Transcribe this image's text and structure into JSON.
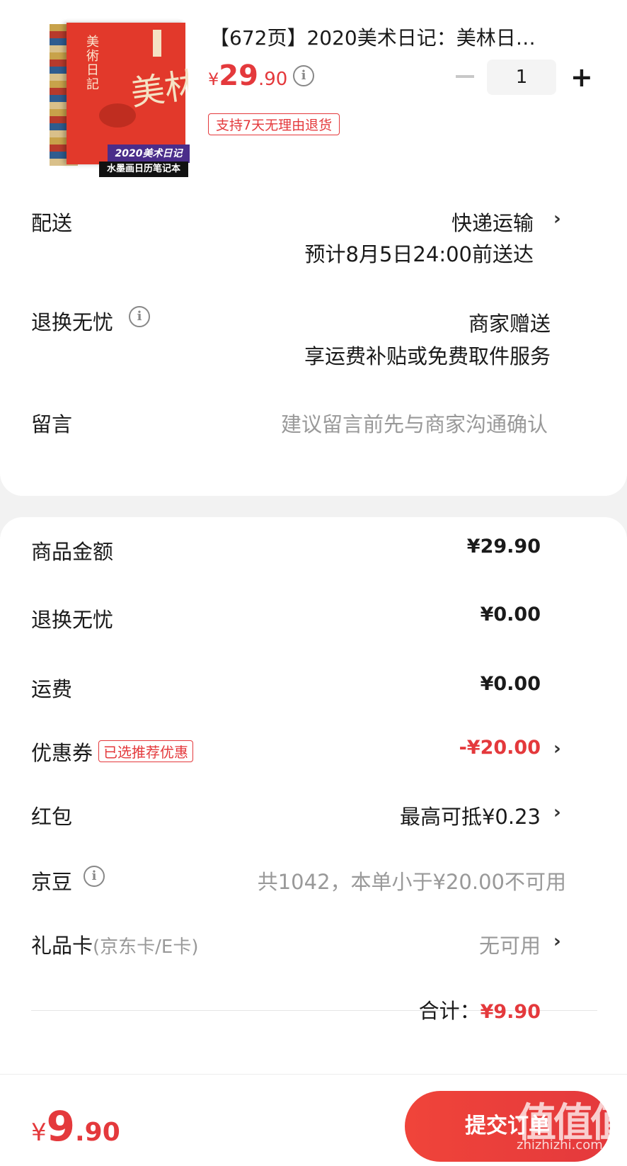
{
  "product": {
    "cover_vertical_title": "美術日記",
    "cover_big_char": "美林",
    "cover_banner_1": "2020美术日记",
    "cover_banner_2": "水墨画日历笔记本",
    "title": "【672页】2020美术日记：美林日…",
    "price_yen": "¥",
    "price_int": "29",
    "price_dec": ".90",
    "quantity": "1",
    "return_tag": "支持7天无理由退货"
  },
  "delivery": {
    "label": "配送",
    "method": "快递运输",
    "estimate": "预计8月5日24:00前送达"
  },
  "return_service": {
    "label": "退换无忧",
    "value": "商家赠送",
    "detail": "享运费补贴或免费取件服务"
  },
  "message": {
    "label": "留言",
    "placeholder": "建议留言前先与商家沟通确认"
  },
  "summary": {
    "goods_amount_label": "商品金额",
    "goods_amount": "¥29.90",
    "return_label": "退换无忧",
    "return_amount": "¥0.00",
    "shipping_label": "运费",
    "shipping_amount": "¥0.00",
    "coupon_label": "优惠券",
    "coupon_tag": "已选推荐优惠",
    "coupon_amount": "-¥20.00",
    "redpacket_label": "红包",
    "redpacket_value": "最高可抵¥0.23",
    "jingdou_label": "京豆",
    "jingdou_value": "共1042，本单小于¥20.00不可用",
    "giftcard_label": "礼品卡",
    "giftcard_sub": "(京东卡/E卡)",
    "giftcard_value": "无可用",
    "total_label": "合计：",
    "total_value": "¥9.90"
  },
  "bottom": {
    "pay_yen": "¥",
    "pay_int": "9",
    "pay_dec": ".90",
    "submit_label": "提交订单",
    "watermark": "值值值",
    "watermark_url": "zhizhizhi.com"
  },
  "colors": {
    "accent_red": "#e4393c",
    "background": "#f2f2f2",
    "muted_text": "#999999"
  },
  "icons": {
    "info": "info-circle-icon",
    "chevron": "chevron-right-icon",
    "minus": "minus-icon",
    "plus": "plus-icon"
  }
}
